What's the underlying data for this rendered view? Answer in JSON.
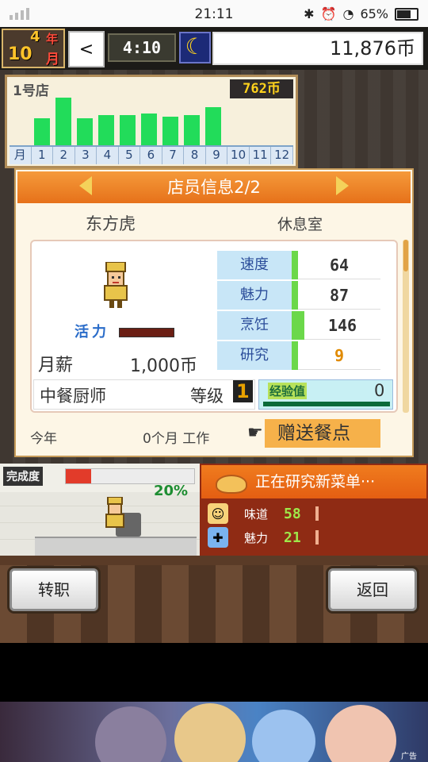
{
  "status_bar": {
    "time": "21:11",
    "battery": "65%"
  },
  "header": {
    "year": "4",
    "year_unit": "年",
    "month": "10",
    "month_unit": "月",
    "clock_time": "4:10",
    "coins": "11,876币"
  },
  "store": {
    "name": "1号店",
    "total": "762币",
    "month_axis_label": "月",
    "months": [
      "1",
      "2",
      "3",
      "4",
      "5",
      "6",
      "7",
      "8",
      "9",
      "10",
      "11",
      "12"
    ]
  },
  "chart_data": {
    "type": "bar",
    "categories": [
      "1",
      "2",
      "3",
      "4",
      "5",
      "6",
      "7",
      "8",
      "9",
      "10",
      "11",
      "12"
    ],
    "values": [
      34,
      60,
      34,
      38,
      38,
      40,
      36,
      38,
      48,
      0,
      0,
      0
    ]
  },
  "staff_panel": {
    "title": "店员信息2/2",
    "staff_name": "东方虎",
    "location": "休息室",
    "vitality_label": "活力",
    "vitality_level": 1.0,
    "salary_label": "月薪",
    "salary_value": "1,000币",
    "stats": [
      {
        "name": "速度",
        "value": "64"
      },
      {
        "name": "魅力",
        "value": "87"
      },
      {
        "name": "烹饪",
        "value": "146"
      },
      {
        "name": "研究",
        "value": "9"
      }
    ],
    "job": "中餐厨师",
    "level_label": "等级",
    "level": "1",
    "exp_label": "经验值",
    "exp_value": "0",
    "year_label": "今年",
    "work_label": "0个月 工作",
    "gift_button": "赠送餐点"
  },
  "kitchen": {
    "done_label": "完成度",
    "progress_percent": "20%",
    "progress": 0.2
  },
  "research": {
    "title": "正在研究新菜单···",
    "rows": [
      {
        "name": "味道",
        "value": "58"
      },
      {
        "name": "魅力",
        "value": "21"
      }
    ]
  },
  "buttons": {
    "transfer": "转职",
    "back": "返回"
  },
  "ad": {
    "label": "广告"
  },
  "colors": {
    "accent_orange": "#e6711a",
    "bar_green": "#22dc5a",
    "stat_blue": "#c8e6f7"
  }
}
